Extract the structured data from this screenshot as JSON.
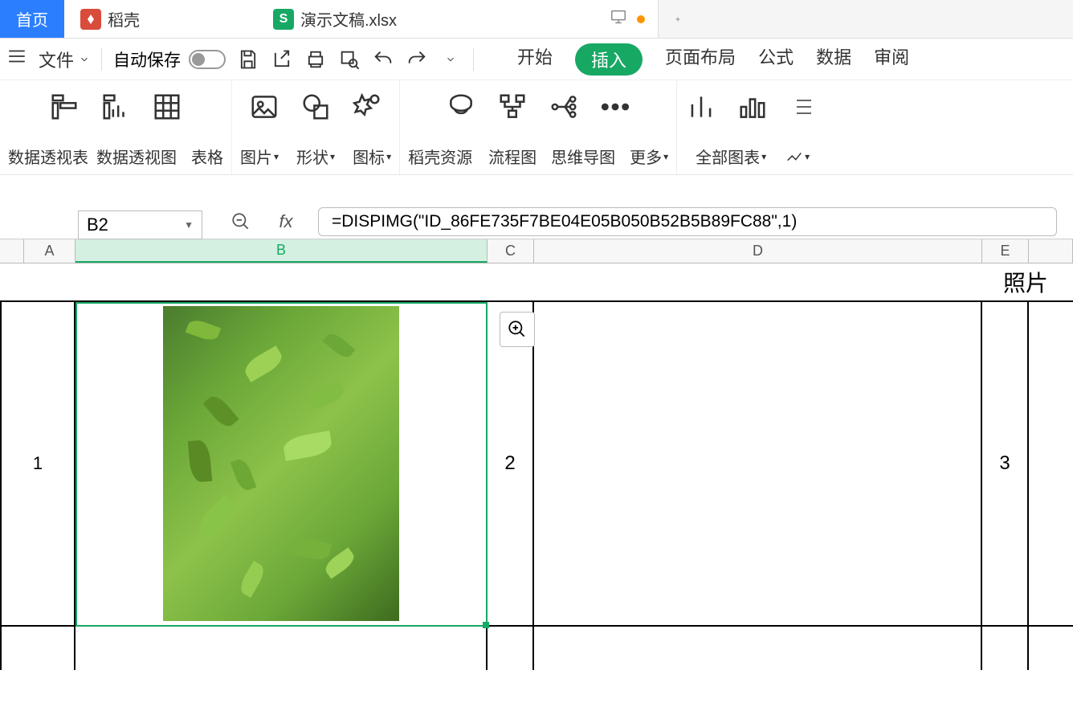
{
  "tabs": {
    "home": "首页",
    "docer": "稻壳",
    "file": "演示文稿.xlsx"
  },
  "qat": {
    "file_label": "文件",
    "autosave_label": "自动保存"
  },
  "menu": {
    "start": "开始",
    "insert": "插入",
    "page_layout": "页面布局",
    "formulas": "公式",
    "data": "数据",
    "review": "审阅"
  },
  "ribbon": {
    "pivot_table": "数据透视表",
    "pivot_chart": "数据透视图",
    "table": "表格",
    "picture": "图片",
    "shapes": "形状",
    "icons": "图标",
    "docer_res": "稻壳资源",
    "flowchart": "流程图",
    "mindmap": "思维导图",
    "more": "更多",
    "all_charts": "全部图表"
  },
  "namebox": "B2",
  "formula": "=DISPIMG(\"ID_86FE735F7BE04E05B050B52B5B89FC88\",1)",
  "cols": {
    "a": "A",
    "b": "B",
    "c": "C",
    "d": "D",
    "e": "E"
  },
  "header_cell": "照片",
  "row_labels": {
    "r1": "1",
    "r2": "2",
    "r3": "3"
  },
  "embedded_image_desc": "green plant leaves"
}
